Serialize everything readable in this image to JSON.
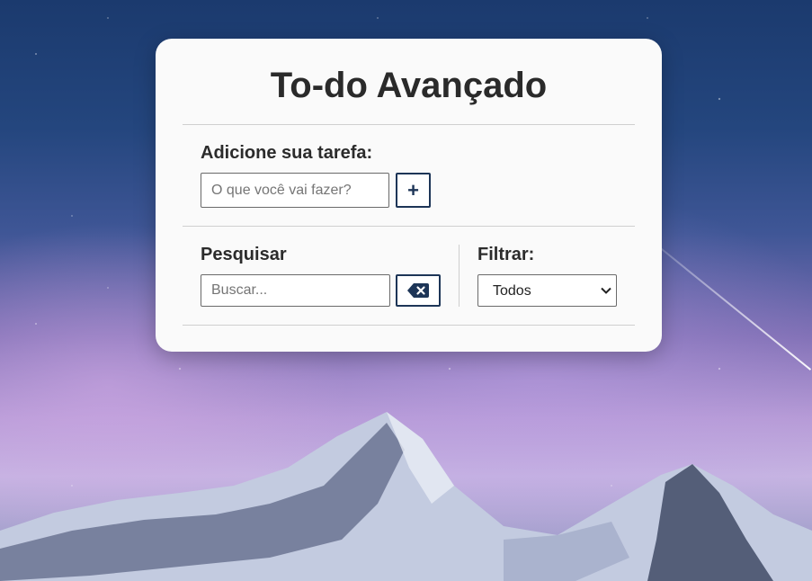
{
  "app": {
    "title": "To-do Avançado"
  },
  "add_task": {
    "label": "Adicione sua tarefa:",
    "placeholder": "O que você vai fazer?",
    "value": "",
    "button_icon": "plus-icon",
    "button_glyph": "+"
  },
  "search": {
    "label": "Pesquisar",
    "placeholder": "Buscar...",
    "value": "",
    "clear_icon": "backspace-icon"
  },
  "filter": {
    "label": "Filtrar:",
    "selected": "Todos",
    "icon": "chevron-down-icon"
  },
  "colors": {
    "accent": "#1d3557",
    "card_bg": "#fafafa",
    "text": "#2b2b2b"
  }
}
